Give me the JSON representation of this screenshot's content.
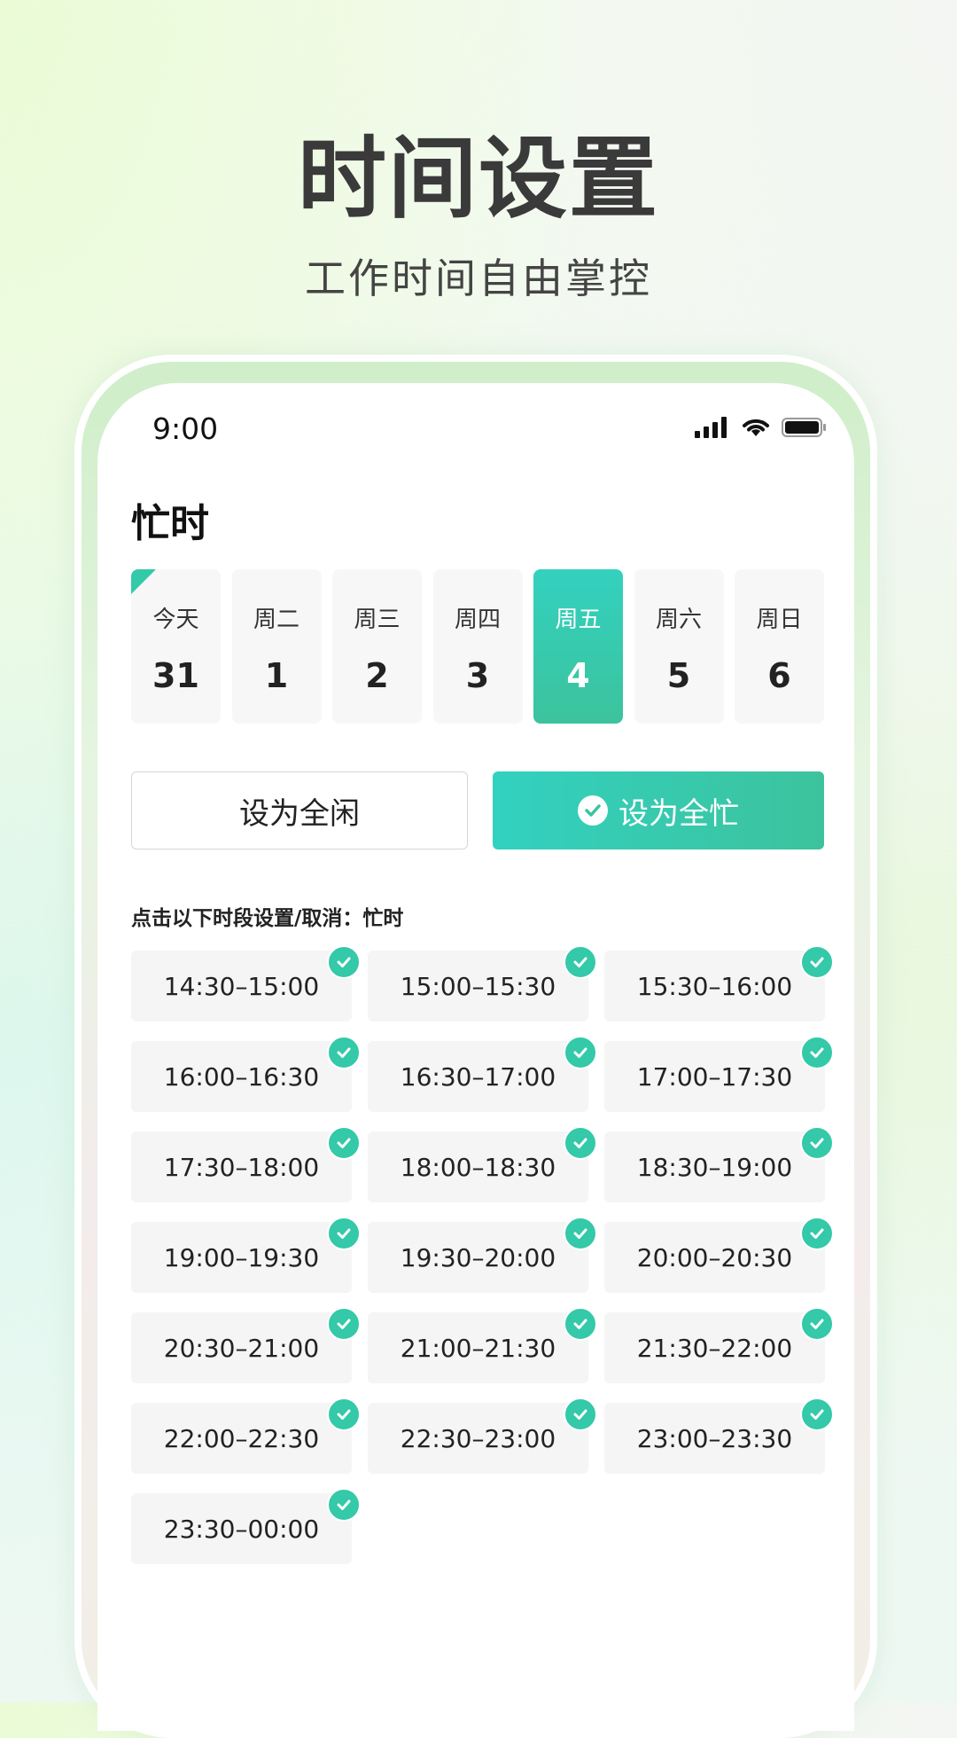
{
  "hero": {
    "title": "时间设置",
    "subtitle": "工作时间自由掌控"
  },
  "status_bar": {
    "time": "9:00"
  },
  "page": {
    "title": "忙时"
  },
  "days": [
    {
      "name": "今天",
      "num": "31",
      "today": true
    },
    {
      "name": "周二",
      "num": "1"
    },
    {
      "name": "周三",
      "num": "2"
    },
    {
      "name": "周四",
      "num": "3"
    },
    {
      "name": "周五",
      "num": "4",
      "selected": true
    },
    {
      "name": "周六",
      "num": "5"
    },
    {
      "name": "周日",
      "num": "6"
    }
  ],
  "buttons": {
    "set_all_idle": "设为全闲",
    "set_all_busy": "设为全忙"
  },
  "hint": "点击以下时段设置/取消：忙时",
  "slots": [
    "14:30–15:00",
    "15:00–15:30",
    "15:30–16:00",
    "16:00–16:30",
    "16:30–17:00",
    "17:00–17:30",
    "17:30–18:00",
    "18:00–18:30",
    "18:30–19:00",
    "19:00–19:30",
    "19:30–20:00",
    "20:00–20:30",
    "20:30–21:00",
    "21:00–21:30",
    "21:30–22:00",
    "22:00–22:30",
    "22:30–23:00",
    "23:00–23:30",
    "23:30–00:00"
  ],
  "colors": {
    "accent": "#34c9a8",
    "accent_start": "#32d1c0",
    "accent_end": "#3cc39d"
  }
}
